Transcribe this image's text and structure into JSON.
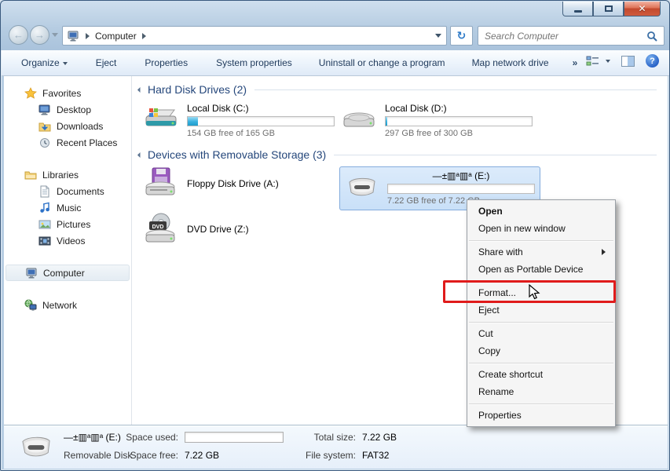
{
  "navbar": {
    "breadcrumb": {
      "root": "Computer"
    },
    "search": {
      "placeholder": "Search Computer"
    }
  },
  "toolbar": {
    "items": [
      "Organize",
      "Eject",
      "Properties",
      "System properties",
      "Uninstall or change a program",
      "Map network drive"
    ],
    "overflow_label": "»"
  },
  "sidebar": {
    "favorites": {
      "label": "Favorites",
      "items": [
        "Desktop",
        "Downloads",
        "Recent Places"
      ]
    },
    "libraries": {
      "label": "Libraries",
      "items": [
        "Documents",
        "Music",
        "Pictures",
        "Videos"
      ]
    },
    "computer": {
      "label": "Computer"
    },
    "network": {
      "label": "Network"
    }
  },
  "content": {
    "groups": [
      {
        "title": "Hard Disk Drives (2)"
      },
      {
        "title": "Devices with Removable Storage (3)"
      }
    ],
    "drives": {
      "c": {
        "name": "Local Disk (C:)",
        "sub": "154 GB free of 165 GB",
        "used_pct": 7
      },
      "d": {
        "name": "Local Disk (D:)",
        "sub": "297 GB free of 300 GB",
        "used_pct": 1.2
      },
      "a": {
        "name": "Floppy Disk Drive (A:)"
      },
      "e": {
        "name": "—±▥ᵃ▥ᵃ (E:)",
        "sub": "7.22 GB free of 7.22 GB",
        "used_pct": 0
      },
      "z": {
        "name": "DVD Drive (Z:)"
      }
    }
  },
  "context_menu": {
    "items": [
      {
        "label": "Open"
      },
      {
        "label": "Open in new window"
      },
      {
        "label": "Share with"
      },
      {
        "label": "Open as Portable Device"
      },
      {
        "label": "Format..."
      },
      {
        "label": "Eject"
      },
      {
        "label": "Cut"
      },
      {
        "label": "Copy"
      },
      {
        "label": "Create shortcut"
      },
      {
        "label": "Rename"
      },
      {
        "label": "Properties"
      }
    ]
  },
  "details_pane": {
    "name": "—±▥ᵃ▥ᵃ (E:)",
    "type": "Removable Disk",
    "space_used_label": "Space used:",
    "space_free_label": "Space free:",
    "space_free_value": "7.22 GB",
    "total_size_label": "Total size:",
    "total_size_value": "7.22 GB",
    "file_system_label": "File system:",
    "file_system_value": "FAT32",
    "used_pct": 0
  },
  "colors": {
    "annotation_red": "#e01b1b",
    "selection_border": "#84acdd",
    "group_header_blue": "#25477b"
  }
}
